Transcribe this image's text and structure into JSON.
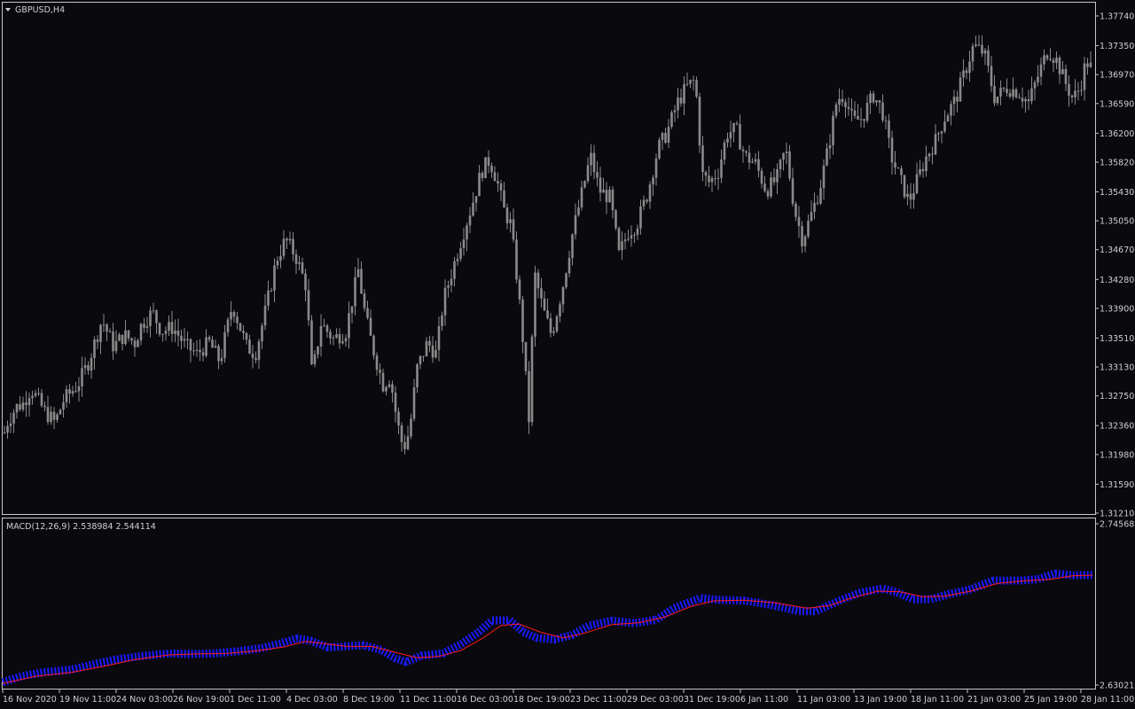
{
  "window": {
    "symbol_label": "GBPUSD,H4",
    "macd_label": "MACD(12,26,9) 2.538984 2.544114"
  },
  "colors": {
    "background": "#09090e",
    "border": "#c8c8c8",
    "candle": "#8a8a8a",
    "macd_main": "#1a1aff",
    "macd_signal": "#ff1a1a",
    "text": "#d0d0d0"
  },
  "chart_data": [
    {
      "type": "candlestick",
      "title": "GBPUSD,H4",
      "ylim": [
        1.3121,
        1.3774
      ],
      "y_ticks": [
        "1.37740",
        "1.37350",
        "1.36970",
        "1.36590",
        "1.36200",
        "1.35820",
        "1.35430",
        "1.35050",
        "1.34670",
        "1.34280",
        "1.33900",
        "1.33510",
        "1.33130",
        "1.32750",
        "1.32360",
        "1.31980",
        "1.31590",
        "1.31210"
      ],
      "x_ticks": [
        "16 Nov 2020",
        "19 Nov 11:00",
        "24 Nov 03:00",
        "26 Nov 19:00",
        "1 Dec 11:00",
        "4 Dec 03:00",
        "8 Dec 19:00",
        "11 Dec 11:00",
        "16 Dec 03:00",
        "18 Dec 19:00",
        "23 Dec 11:00",
        "29 Dec 03:00",
        "31 Dec 19:00",
        "6 Jan 11:00",
        "11 Jan 03:00",
        "13 Jan 19:00",
        "18 Jan 11:00",
        "21 Jan 03:00",
        "25 Jan 19:00",
        "28 Jan 11:00"
      ],
      "close_path": [
        [
          0,
          1.3205
        ],
        [
          8,
          1.324
        ],
        [
          18,
          1.326
        ],
        [
          26,
          1.3265
        ],
        [
          35,
          1.3285
        ],
        [
          50,
          1.3255
        ],
        [
          62,
          1.324
        ],
        [
          72,
          1.327
        ],
        [
          88,
          1.329
        ],
        [
          100,
          1.332
        ],
        [
          115,
          1.3375
        ],
        [
          128,
          1.334
        ],
        [
          140,
          1.3355
        ],
        [
          152,
          1.3345
        ],
        [
          160,
          1.337
        ],
        [
          172,
          1.3385
        ],
        [
          182,
          1.336
        ],
        [
          195,
          1.3365
        ],
        [
          210,
          1.334
        ],
        [
          222,
          1.333
        ],
        [
          236,
          1.3345
        ],
        [
          248,
          1.332
        ],
        [
          262,
          1.3395
        ],
        [
          278,
          1.334
        ],
        [
          288,
          1.333
        ],
        [
          300,
          1.339
        ],
        [
          312,
          1.3455
        ],
        [
          322,
          1.348
        ],
        [
          333,
          1.346
        ],
        [
          345,
          1.342
        ],
        [
          352,
          1.33
        ],
        [
          362,
          1.337
        ],
        [
          376,
          1.335
        ],
        [
          390,
          1.336
        ],
        [
          404,
          1.344
        ],
        [
          412,
          1.338
        ],
        [
          420,
          1.334
        ],
        [
          432,
          1.329
        ],
        [
          440,
          1.33
        ],
        [
          448,
          1.324
        ],
        [
          455,
          1.3205
        ],
        [
          462,
          1.323
        ],
        [
          470,
          1.331
        ],
        [
          482,
          1.3345
        ],
        [
          492,
          1.333
        ],
        [
          500,
          1.34
        ],
        [
          510,
          1.344
        ],
        [
          520,
          1.348
        ],
        [
          532,
          1.3525
        ],
        [
          543,
          1.357
        ],
        [
          552,
          1.3585
        ],
        [
          560,
          1.356
        ],
        [
          568,
          1.352
        ],
        [
          576,
          1.35
        ],
        [
          584,
          1.342
        ],
        [
          592,
          1.332
        ],
        [
          596,
          1.323
        ],
        [
          603,
          1.3435
        ],
        [
          612,
          1.339
        ],
        [
          622,
          1.3355
        ],
        [
          634,
          1.3415
        ],
        [
          646,
          1.349
        ],
        [
          656,
          1.354
        ],
        [
          666,
          1.359
        ],
        [
          676,
          1.3545
        ],
        [
          688,
          1.3535
        ],
        [
          698,
          1.346
        ],
        [
          708,
          1.349
        ],
        [
          718,
          1.35
        ],
        [
          730,
          1.354
        ],
        [
          742,
          1.36
        ],
        [
          752,
          1.362
        ],
        [
          764,
          1.366
        ],
        [
          774,
          1.368
        ],
        [
          784,
          1.369
        ],
        [
          792,
          1.3565
        ],
        [
          800,
          1.3555
        ],
        [
          810,
          1.357
        ],
        [
          820,
          1.362
        ],
        [
          830,
          1.3625
        ],
        [
          840,
          1.359
        ],
        [
          852,
          1.358
        ],
        [
          864,
          1.3545
        ],
        [
          876,
          1.356
        ],
        [
          886,
          1.36
        ],
        [
          896,
          1.352
        ],
        [
          905,
          1.348
        ],
        [
          914,
          1.351
        ],
        [
          924,
          1.3545
        ],
        [
          934,
          1.36
        ],
        [
          944,
          1.3665
        ],
        [
          952,
          1.367
        ],
        [
          962,
          1.3635
        ],
        [
          972,
          1.364
        ],
        [
          985,
          1.367
        ],
        [
          995,
          1.365
        ],
        [
          1005,
          1.359
        ],
        [
          1015,
          1.356
        ],
        [
          1025,
          1.353
        ],
        [
          1035,
          1.356
        ],
        [
          1045,
          1.359
        ],
        [
          1055,
          1.361
        ],
        [
          1065,
          1.364
        ],
        [
          1078,
          1.3665
        ],
        [
          1088,
          1.37
        ],
        [
          1098,
          1.3735
        ],
        [
          1110,
          1.3725
        ],
        [
          1122,
          1.3665
        ],
        [
          1135,
          1.368
        ],
        [
          1148,
          1.3675
        ],
        [
          1160,
          1.366
        ],
        [
          1172,
          1.37
        ],
        [
          1182,
          1.373
        ],
        [
          1192,
          1.3715
        ],
        [
          1200,
          1.369
        ],
        [
          1210,
          1.3665
        ],
        [
          1218,
          1.368
        ],
        [
          1225,
          1.3715
        ],
        [
          1231,
          1.3705
        ]
      ]
    },
    {
      "type": "line",
      "title": "MACD(12,26,9) 2.538984 2.544114",
      "ylim": [
        2.630212,
        2.745687
      ],
      "y_ticks": [
        "2.745687",
        "2.630212"
      ],
      "series": [
        {
          "name": "main",
          "color": "#1a1aff",
          "points": [
            [
              3,
              2.6322
            ],
            [
              25,
              2.6367
            ],
            [
              50,
              2.6395
            ],
            [
              80,
              2.6412
            ],
            [
              105,
              2.645
            ],
            [
              130,
              2.6485
            ],
            [
              160,
              2.651
            ],
            [
              190,
              2.6528
            ],
            [
              215,
              2.6524
            ],
            [
              240,
              2.6528
            ],
            [
              270,
              2.6545
            ],
            [
              295,
              2.6567
            ],
            [
              315,
              2.6598
            ],
            [
              335,
              2.6635
            ],
            [
              350,
              2.662
            ],
            [
              370,
              2.6572
            ],
            [
              390,
              2.658
            ],
            [
              410,
              2.6587
            ],
            [
              430,
              2.6553
            ],
            [
              446,
              2.6493
            ],
            [
              458,
              2.6468
            ],
            [
              475,
              2.6512
            ],
            [
              500,
              2.653
            ],
            [
              520,
              2.6595
            ],
            [
              540,
              2.6683
            ],
            [
              555,
              2.6765
            ],
            [
              575,
              2.6765
            ],
            [
              590,
              2.6683
            ],
            [
              605,
              2.664
            ],
            [
              625,
              2.6628
            ],
            [
              645,
              2.666
            ],
            [
              665,
              2.673
            ],
            [
              690,
              2.6762
            ],
            [
              715,
              2.6745
            ],
            [
              740,
              2.677
            ],
            [
              760,
              2.6853
            ],
            [
              790,
              2.6925
            ],
            [
              810,
              2.6912
            ],
            [
              840,
              2.6907
            ],
            [
              870,
              2.6875
            ],
            [
              900,
              2.6833
            ],
            [
              920,
              2.683
            ],
            [
              945,
              2.6903
            ],
            [
              970,
              2.6963
            ],
            [
              995,
              2.6993
            ],
            [
              1010,
              2.697
            ],
            [
              1030,
              2.6915
            ],
            [
              1050,
              2.6917
            ],
            [
              1070,
              2.6953
            ],
            [
              1095,
              2.6988
            ],
            [
              1120,
              2.705
            ],
            [
              1150,
              2.705
            ],
            [
              1170,
              2.706
            ],
            [
              1190,
              2.71
            ],
            [
              1210,
              2.7088
            ],
            [
              1232,
              2.709
            ]
          ]
        },
        {
          "name": "signal",
          "color": "#ff1a1a",
          "points": [
            [
              3,
              2.6314
            ],
            [
              40,
              2.6365
            ],
            [
              80,
              2.6392
            ],
            [
              120,
              2.644
            ],
            [
              150,
              2.6483
            ],
            [
              190,
              2.6518
            ],
            [
              220,
              2.6525
            ],
            [
              255,
              2.6528
            ],
            [
              290,
              2.6548
            ],
            [
              320,
              2.6575
            ],
            [
              345,
              2.6615
            ],
            [
              370,
              2.6595
            ],
            [
              390,
              2.658
            ],
            [
              420,
              2.6578
            ],
            [
              450,
              2.653
            ],
            [
              470,
              2.6498
            ],
            [
              495,
              2.6508
            ],
            [
              520,
              2.655
            ],
            [
              545,
              2.664
            ],
            [
              565,
              2.6728
            ],
            [
              585,
              2.674
            ],
            [
              610,
              2.668
            ],
            [
              635,
              2.664
            ],
            [
              660,
              2.6675
            ],
            [
              690,
              2.6735
            ],
            [
              720,
              2.6748
            ],
            [
              750,
              2.679
            ],
            [
              780,
              2.6867
            ],
            [
              805,
              2.6905
            ],
            [
              840,
              2.691
            ],
            [
              875,
              2.689
            ],
            [
              910,
              2.6853
            ],
            [
              935,
              2.687
            ],
            [
              960,
              2.6925
            ],
            [
              990,
              2.6975
            ],
            [
              1015,
              2.697
            ],
            [
              1040,
              2.6935
            ],
            [
              1065,
              2.6938
            ],
            [
              1095,
              2.6975
            ],
            [
              1125,
              2.703
            ],
            [
              1155,
              2.7048
            ],
            [
              1185,
              2.706
            ],
            [
              1210,
              2.7085
            ],
            [
              1232,
              2.7088
            ]
          ]
        }
      ]
    }
  ]
}
